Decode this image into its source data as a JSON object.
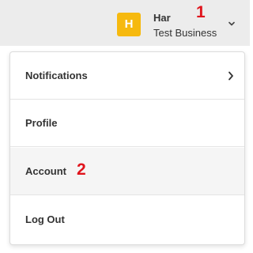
{
  "header": {
    "avatar_letter": "H",
    "avatar_color": "#f6b90f",
    "user_name": "Har",
    "business_name": "Test Business",
    "dropdown_icon": "chevron-down-icon"
  },
  "callouts": {
    "one": "1",
    "two": "2",
    "color": "#e0141c"
  },
  "menu": {
    "items": [
      {
        "label": "Notifications",
        "icon": "chevron-right-icon"
      },
      {
        "label": "Profile"
      },
      {
        "label": "Account"
      },
      {
        "label": "Log Out"
      }
    ]
  }
}
